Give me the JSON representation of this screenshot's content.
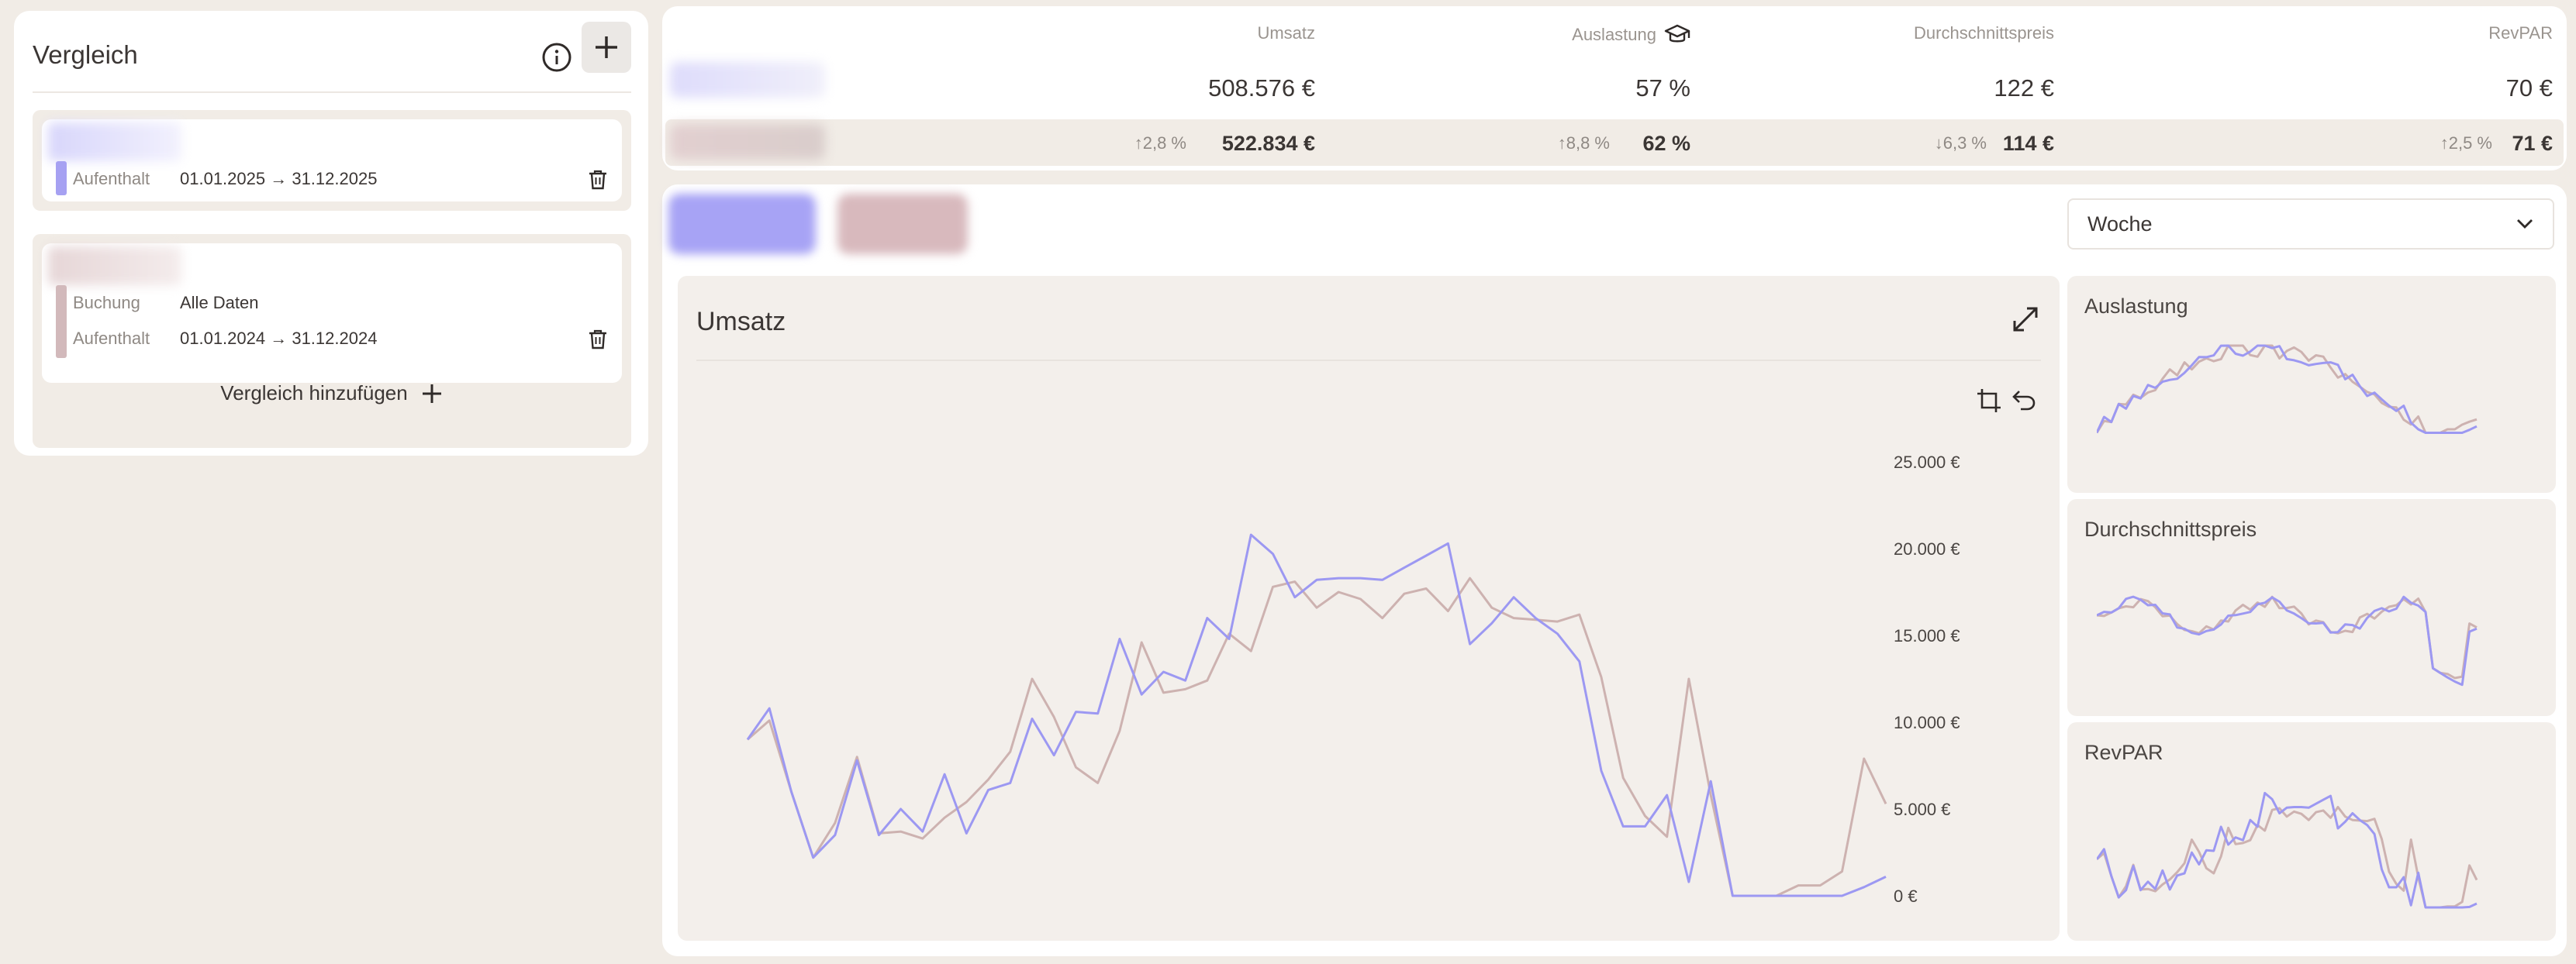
{
  "comparison": {
    "title": "Vergleich",
    "cards": [
      {
        "color": "#a6a1f2",
        "rows": [
          {
            "label": "Aufenthalt",
            "value": "01.01.2025 → 31.12.2025"
          }
        ]
      },
      {
        "color": "#d2b9bb",
        "rows": [
          {
            "label": "Buchung",
            "value": "Alle Daten"
          },
          {
            "label": "Aufenthalt",
            "value": "01.01.2024 → 31.12.2024"
          }
        ]
      }
    ],
    "add_label": "Vergleich hinzufügen"
  },
  "kpis": {
    "headers": [
      "Umsatz",
      "Auslastung",
      "Durchschnittspreis",
      "RevPAR"
    ],
    "primary": [
      "508.576 €",
      "57 %",
      "122 €",
      "70 €"
    ],
    "compare": [
      "522.834 €",
      "62 %",
      "114 €",
      "71 €"
    ],
    "deltas": [
      "2,8 %",
      "8,8 %",
      "6,3 %",
      "2,5 %"
    ],
    "delta_dirs": [
      "up",
      "up",
      "down",
      "up"
    ]
  },
  "main": {
    "period": "Woche",
    "chart_title": "Umsatz",
    "side_titles": [
      "Auslastung",
      "Durchschnittspreis",
      "RevPAR"
    ]
  },
  "colors": {
    "series_primary": "#9c98f2",
    "series_compare": "#cdb2b0",
    "background": "#f1ece6"
  },
  "chart_data": {
    "type": "line",
    "title": "Umsatz",
    "x": [
      1,
      2,
      3,
      4,
      5,
      6,
      7,
      8,
      9,
      10,
      11,
      12,
      13,
      14,
      15,
      16,
      17,
      18,
      19,
      20,
      21,
      22,
      23,
      24,
      25,
      26,
      27,
      28,
      29,
      30,
      31,
      32,
      33,
      34,
      35,
      36,
      37,
      38,
      39,
      40,
      41,
      42,
      43,
      44,
      45,
      46,
      47,
      48,
      49,
      50,
      51,
      52,
      53
    ],
    "yticks": [
      "0 €",
      "5.000 €",
      "10.000 €",
      "15.000 €",
      "20.000 €",
      "25.000 €"
    ],
    "ylim": [
      0,
      25000
    ],
    "y_axis_position": "right",
    "series": [
      {
        "values": [
          9000,
          10800,
          6000,
          2200,
          3500,
          7800,
          3500,
          5000,
          3700,
          7000,
          3600,
          6100,
          6500,
          10200,
          8100,
          10600,
          10500,
          14800,
          11600,
          12900,
          12400,
          16000,
          14800,
          20800,
          19700,
          17200,
          18200,
          18300,
          18300,
          18200,
          18900,
          19600,
          20300,
          14500,
          15700,
          17200,
          16000,
          15100,
          13500,
          7200,
          4000,
          4000,
          5800,
          800,
          6600,
          0,
          0,
          0,
          0,
          0,
          0,
          500,
          1100
        ]
      },
      {
        "values": [
          9000,
          10100,
          6000,
          2200,
          4200,
          8000,
          3600,
          3700,
          3300,
          4500,
          5400,
          6700,
          8300,
          12500,
          10300,
          7400,
          6500,
          9500,
          14600,
          11700,
          11900,
          12400,
          15100,
          14100,
          17800,
          18100,
          16600,
          17500,
          17100,
          16000,
          17400,
          17700,
          16400,
          18300,
          16600,
          16000,
          15900,
          15800,
          16200,
          12600,
          6800,
          4600,
          3400,
          12500,
          5800,
          0,
          0,
          0,
          600,
          600,
          1400,
          7900,
          5300
        ]
      }
    ]
  }
}
